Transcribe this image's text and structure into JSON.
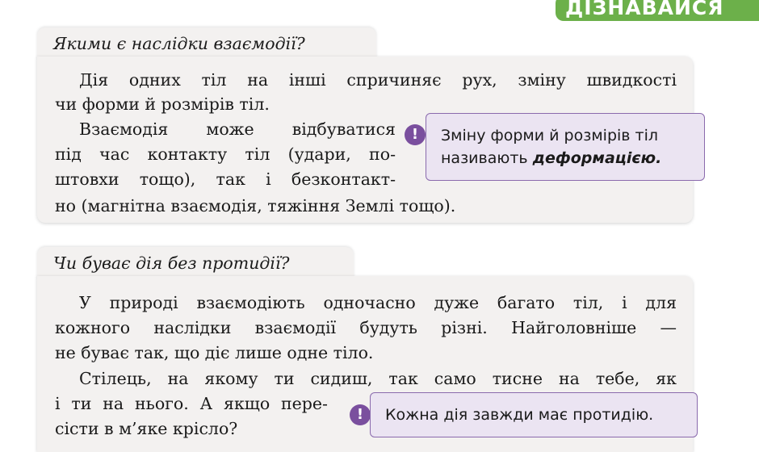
{
  "header": {
    "badge_label": "ДІЗНАВАЙСЯ"
  },
  "section1": {
    "question": "Якими є наслідки взаємодії?",
    "lines": [
      "Дія одних тіл на інші спричиняє рух, зміну швидкості",
      "чи форми й розмірів тіл.",
      "Взаємодія може відбуватися",
      "під час контакту тіл (удари, по-",
      "штовхи тощо), так і безконтакт-",
      "но (магнітна взаємодія, тяжіння Землі тощо)."
    ],
    "note": {
      "mark": "!",
      "line1": "Зміну форми й розмірів тіл",
      "line2_prefix": "називають ",
      "line2_term": "деформацією."
    }
  },
  "section2": {
    "question": "Чи буває дія без протидії?",
    "lines": [
      "У природі взаємодіють одночасно дуже багато тіл, і для",
      "кожного наслідки взаємодії будуть різні. Найголовніше —",
      "не буває так, що діє лише одне тіло.",
      "Стілець, на якому ти сидиш, так само тисне на тебе, як",
      "і ти на нього. А якщо пере-",
      "сісти в м’яке крісло?"
    ],
    "note": {
      "mark": "!",
      "text": "Кожна дія завжди має протидію."
    }
  },
  "colors": {
    "badge_green": "#6cb04a",
    "note_purple": "#7a4f9e",
    "note_fill": "#ebe4f2",
    "card_fill": "#f3f1f0"
  }
}
